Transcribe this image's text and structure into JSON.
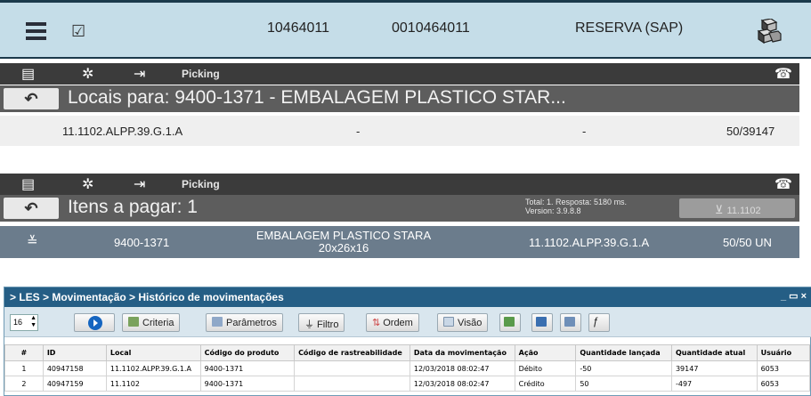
{
  "reserve_row": {
    "code1": "10464011",
    "code2": "0010464011",
    "type": "RESERVA (SAP)",
    "icons": [
      "list-icon",
      "checkbox-icon",
      "boxes-icon"
    ]
  },
  "panel1": {
    "header_title": "Picking",
    "title": "Locais para: 9400-1371 - EMBALAGEM PLASTICO STAR...",
    "row": {
      "local": "11.1102.ALPP.39.G.1.A",
      "col2": "-",
      "col3": "-",
      "qty": "50/39147"
    }
  },
  "panel2": {
    "header_title": "Picking",
    "title": "Itens a pagar: 1",
    "total_line": "Total: 1. Resposta: 5180 ms.",
    "version_line": "Version: 3.9.8.8",
    "cart_label": "11.1102",
    "row": {
      "product": "9400-1371",
      "desc_line1": "EMBALAGEM PLASTICO STARA",
      "desc_line2": "20x26x16",
      "local": "11.1102.ALPP.39.G.1.A",
      "qty": "50/50 UN"
    }
  },
  "les": {
    "breadcrumb": "> LES > Movimentação > Histórico de movimentações",
    "page_size": "16",
    "toolbar": {
      "criteria": "Criteria",
      "parametros": "Parâmetros",
      "filtro": "Filtro",
      "ordem": "Ordem",
      "visao": "Visão"
    },
    "columns": [
      "#",
      "ID",
      "Local",
      "Código do produto",
      "Código de rastreabilidade",
      "Data da movimentação",
      "Ação",
      "Quantidade lançada",
      "Quantidade atual",
      "Usuário"
    ],
    "rows": [
      [
        "1",
        "40947158",
        "11.1102.ALPP.39.G.1.A",
        "9400-1371",
        "",
        "12/03/2018 08:02:47",
        "Débito",
        "-50",
        "39147",
        "6053"
      ],
      [
        "2",
        "40947159",
        "11.1102",
        "9400-1371",
        "",
        "12/03/2018 08:02:47",
        "Crédito",
        "50",
        "-497",
        "6053"
      ]
    ]
  },
  "colors": {
    "reserve_bg": "#c5dde8",
    "header_dark": "#3b3b3b",
    "title_gray": "#5d5d5d",
    "selected_row": "#6b7c8c",
    "les_title": "#255e85"
  }
}
